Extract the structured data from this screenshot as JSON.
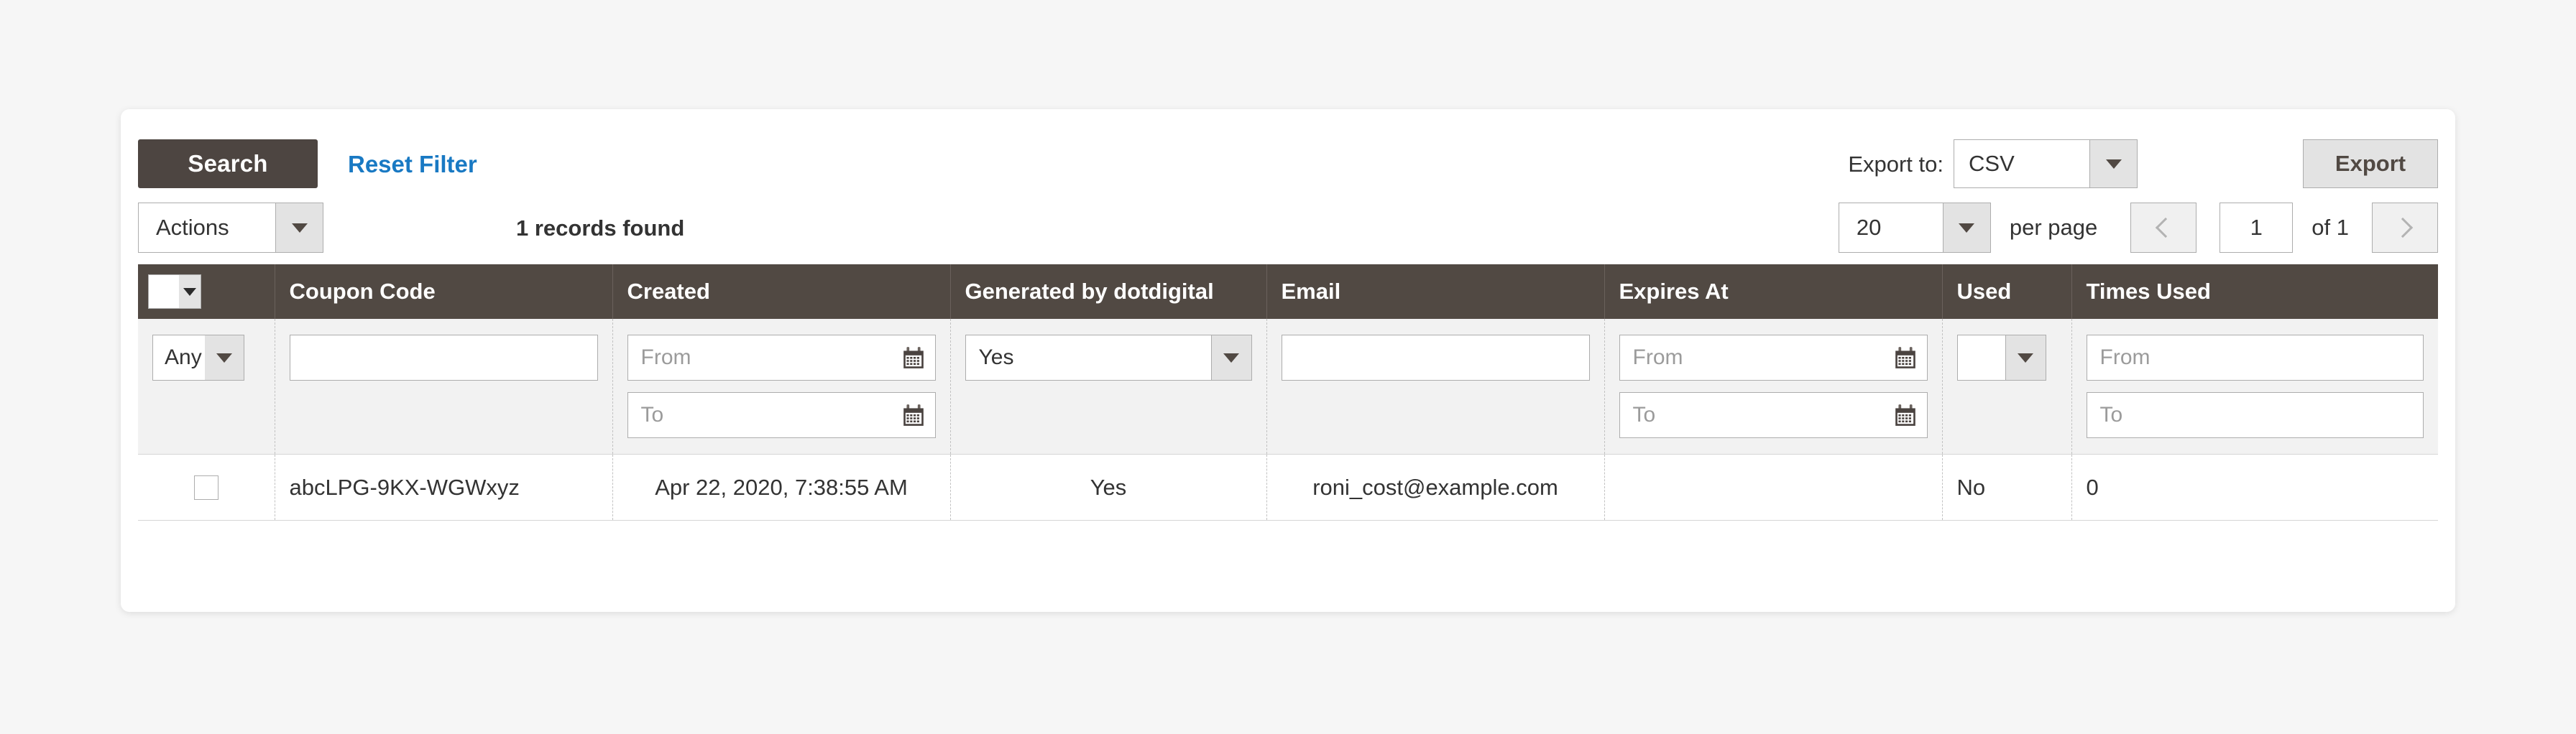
{
  "toolbar": {
    "search_label": "Search",
    "reset_filter_label": "Reset Filter",
    "export_to_label": "Export to:",
    "export_format_value": "CSV",
    "export_button_label": "Export"
  },
  "controls": {
    "actions_label": "Actions",
    "records_found": "1 records found",
    "per_page_value": "20",
    "per_page_label": "per page",
    "page_value": "1",
    "of_total": "of 1"
  },
  "grid": {
    "columns": [
      {
        "key": "select",
        "label": ""
      },
      {
        "key": "coupon",
        "label": "Coupon Code"
      },
      {
        "key": "created",
        "label": "Created"
      },
      {
        "key": "generated",
        "label": "Generated by dotdigital"
      },
      {
        "key": "email",
        "label": "Email"
      },
      {
        "key": "expires",
        "label": "Expires At"
      },
      {
        "key": "used",
        "label": "Used"
      },
      {
        "key": "times",
        "label": "Times Used"
      }
    ],
    "filters": {
      "select_any": "Any",
      "coupon_value": "",
      "created_from_placeholder": "From",
      "created_to_placeholder": "To",
      "generated_value": "Yes",
      "email_value": "",
      "expires_from_placeholder": "From",
      "expires_to_placeholder": "To",
      "used_value": "",
      "times_from_placeholder": "From",
      "times_to_placeholder": "To"
    },
    "rows": [
      {
        "coupon": "abcLPG-9KX-WGWxyz",
        "created": "Apr 22, 2020, 7:38:55 AM",
        "generated": "Yes",
        "email": "roni_cost@example.com",
        "expires": "",
        "used": "No",
        "times": "0"
      }
    ]
  },
  "colors": {
    "header_dark": "#514943",
    "button_dark": "#4d4541",
    "link_blue": "#1979c3",
    "filter_row_bg": "#f2f2f2",
    "page_bg": "#f6f6f6"
  }
}
